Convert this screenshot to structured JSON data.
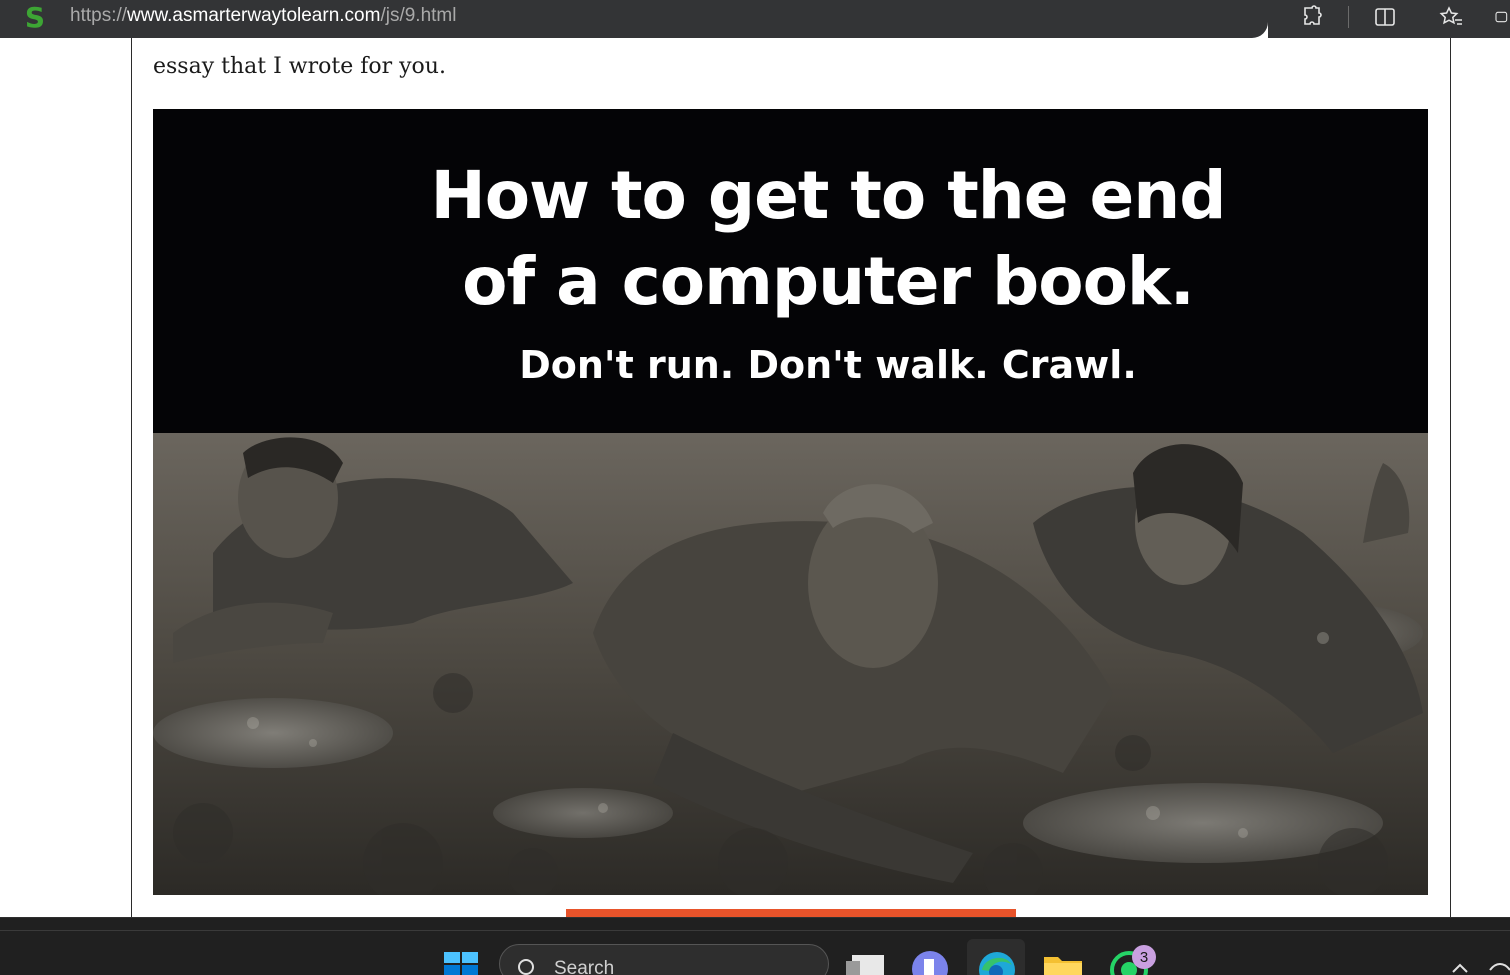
{
  "browser": {
    "logo_letter": "S",
    "url_scheme": "https://",
    "url_host": "www.asmarterwaytolearn.com",
    "url_path": "/js/9.html",
    "toolbar_icons": [
      "extensions-icon",
      "split-screen-icon",
      "favorites-icon",
      "collections-icon"
    ]
  },
  "page": {
    "essay_line": "essay that I wrote for you.",
    "hero": {
      "title_line1": "How to get to the end",
      "title_line2": "of a computer book.",
      "subtitle": "Don't run. Don't walk. Crawl."
    },
    "accent_color": "#e8532a"
  },
  "taskbar": {
    "search_label": "Search",
    "whatsapp_badge": "3",
    "apps": [
      "start-icon",
      "search-icon",
      "task-view-icon",
      "teams-icon",
      "edge-icon",
      "file-explorer-icon",
      "whatsapp-icon"
    ]
  }
}
